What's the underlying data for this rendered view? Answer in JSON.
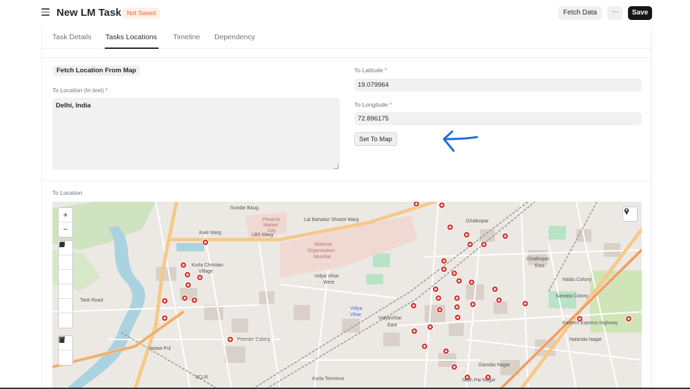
{
  "header": {
    "title": "New LM Task",
    "status": "Not Saved",
    "fetch_data_label": "Fetch Data",
    "more_label": "···",
    "save_label": "Save"
  },
  "tabs": [
    {
      "label": "Task Details",
      "active": false
    },
    {
      "label": "Tasks Locations",
      "active": true
    },
    {
      "label": "Timeline",
      "active": false
    },
    {
      "label": "Dependency",
      "active": false
    }
  ],
  "form": {
    "fetch_location_label": "Fetch Location From Map",
    "to_location_text_label": "To Location (In text)",
    "to_location_text_value": "Delhi, India",
    "to_latitude_label": "To Latitude",
    "to_latitude_value": "19.079964",
    "to_longitude_label": "To Longitude",
    "to_longitude_value": "72.896175",
    "set_to_map_label": "Set To Map",
    "required_mark": "*",
    "to_location_label": "To Location"
  },
  "map": {
    "zoom_in": "+",
    "zoom_out": "−",
    "draw_tools": [
      "polyline-icon",
      "polygon-icon",
      "rectangle-icon",
      "circle-icon",
      "marker-icon",
      "circlemarker-icon"
    ],
    "edit_tools": [
      "edit-icon",
      "delete-icon"
    ],
    "labels": [
      "Sundar Baug",
      "Phoenix",
      "Market",
      "City",
      "Kale Marg",
      "LBS Marg",
      "Lal Bahadur Shastri Marg",
      "Material",
      "Organization",
      "Mumbai",
      "Kurla Christian",
      "Village",
      "Vidya Vihar",
      "West",
      "Vidya",
      "Vihar",
      "VidyaVihar",
      "East",
      "Ghatkopar",
      "Ghatkopar",
      "East",
      "Naidu Colony",
      "Samata Colony",
      "Nalanda Nagar",
      "Garodia Nagar",
      "Nath Pai Nagar",
      "Premier Colony",
      "Kurla Terminus",
      "Halaw Pul",
      "SCLR",
      "Tank Road",
      "Eastern Express Highway"
    ],
    "colors": {
      "marker": "#d0342c",
      "road_major": "#f6c98a",
      "water": "#aad3df",
      "park": "#c8e6b4",
      "building": "#d9d0c9"
    }
  }
}
